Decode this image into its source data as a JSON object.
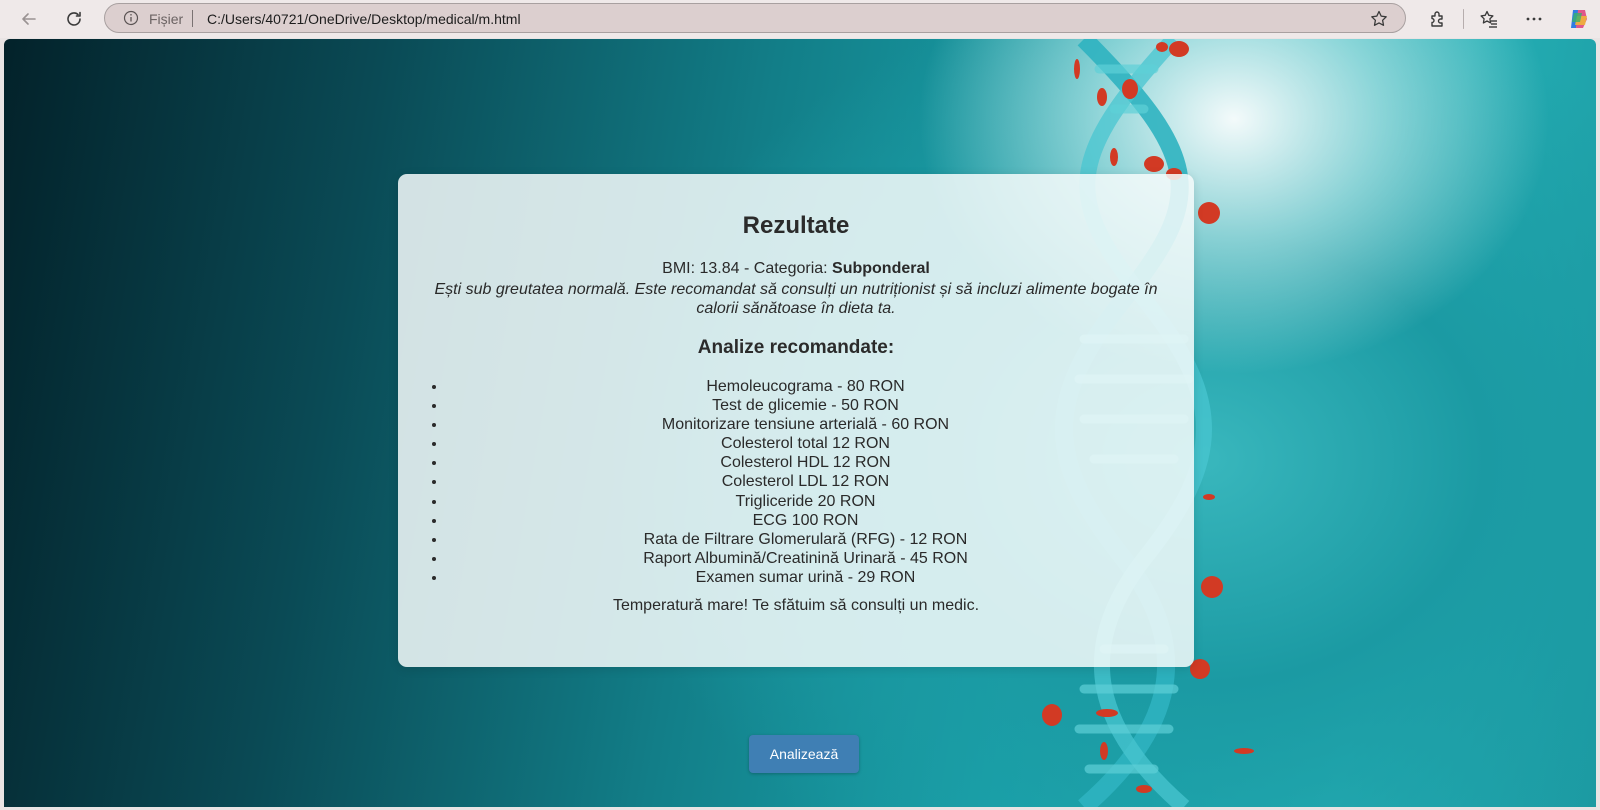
{
  "browser": {
    "address_label": "Fișier",
    "url": "C:/Users/40721/OneDrive/Desktop/medical/m.html"
  },
  "results": {
    "title": "Rezultate",
    "bmi_prefix": "BMI: 13.84 - Categoria: ",
    "bmi_category": "Subponderal",
    "advice": "Ești sub greutatea normală. Este recomandat să consulți un nutriționist și să incluzi alimente bogate în calorii sănătoase în dieta ta.",
    "recommended_heading": "Analize recomandate:",
    "tests": [
      "Hemoleucograma - 80 RON",
      "Test de glicemie - 50 RON",
      "Monitorizare tensiune arterială - 60 RON",
      "Colesterol total 12 RON",
      "Colesterol HDL 12 RON",
      "Colesterol LDL 12 RON",
      "Trigliceride 20 RON",
      "ECG 100 RON",
      "Rata de Filtrare Glomerulară (RFG) - 12 RON",
      "Raport Albumină/Creatinină Urinară - 45 RON",
      "Examen sumar urină - 29 RON"
    ],
    "temperature_warning": "Temperatură mare! Te sfătuim să consulți un medic."
  },
  "actions": {
    "analyze_label": "Analizează"
  },
  "icons": {
    "back": "back-arrow-icon",
    "reload": "reload-icon",
    "info": "info-icon",
    "favorite": "star-icon",
    "extensions": "puzzle-icon",
    "favorites": "favorites-icon",
    "more": "more-icon",
    "copilot": "copilot-icon"
  },
  "colors": {
    "button": "#3f7fb4",
    "background_dark": "#03222a",
    "background_teal": "#1aa2aa",
    "helix": "#2fb3c0",
    "blood_cell": "#d23a24"
  }
}
